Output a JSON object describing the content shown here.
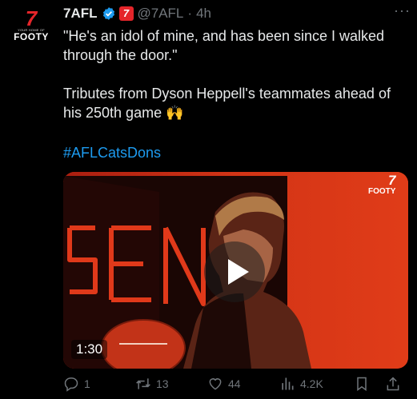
{
  "avatar": {
    "logo_mark": "7",
    "tagline": "YOUR HOME OF",
    "brand": "FOOTY"
  },
  "tweet": {
    "author_name": "7AFL",
    "handle": "@7AFL",
    "separator": "·",
    "time": "4h",
    "more": "···",
    "paragraph1": "\"He's an idol of mine, and has been since I walked through the door.\"",
    "paragraph2": "Tributes from Dyson Heppell's teammates ahead of his 250th game 🙌",
    "hashtag": "#AFLCatsDons"
  },
  "media": {
    "duration": "1:30",
    "watermark_mark": "7",
    "watermark_brand": "FOOTY",
    "backdrop_letters": "SEN",
    "play_icon": "play-icon"
  },
  "actions": {
    "replies": "1",
    "retweets": "13",
    "likes": "44",
    "views": "4.2K"
  },
  "colors": {
    "accent": "#1d9bf0",
    "brand_red": "#e5252a",
    "muted": "#71767b"
  }
}
